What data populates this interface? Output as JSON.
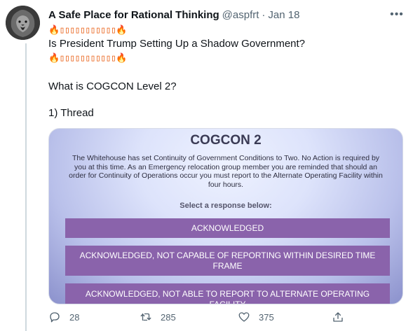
{
  "tweet": {
    "author_name": "A Safe Place for Rational Thinking",
    "handle": "@aspfrt",
    "separator": "·",
    "date": "Jan 18",
    "more_label": "•••",
    "lines": {
      "banner1": "🔥▯▯▯▯▯▯▯▯▯▯▯🔥",
      "question": "Is President Trump Setting Up a Shadow Government?",
      "banner2": "🔥▯▯▯▯▯▯▯▯▯▯▯🔥",
      "subheading": "What is COGCON Level 2?",
      "thread": "1) Thread"
    }
  },
  "card": {
    "title": "COGCON 2",
    "body": "The Whitehouse has set Continuity of Government Conditions to Two. No Action is required by you at this time. As an Emergency relocation group member you are reminded that should an order for Continuity of Operations occur you must report to the Alternate Operating Facility within four hours.",
    "select_prompt": "Select a response below:",
    "options": [
      "ACKNOWLEDGED",
      "ACKNOWLEDGED, NOT CAPABLE OF REPORTING WITHIN DESIRED TIME FRAME",
      "ACKNOWLEDGED, NOT ABLE TO REPORT TO ALTERNATE OPERATING FACILITY"
    ],
    "option_color": "#8a63ab"
  },
  "actions": {
    "replies": "28",
    "retweets": "285",
    "likes": "375"
  },
  "colors": {
    "text": "#0f1419",
    "muted": "#536471",
    "thread_line": "#cfd9de"
  }
}
